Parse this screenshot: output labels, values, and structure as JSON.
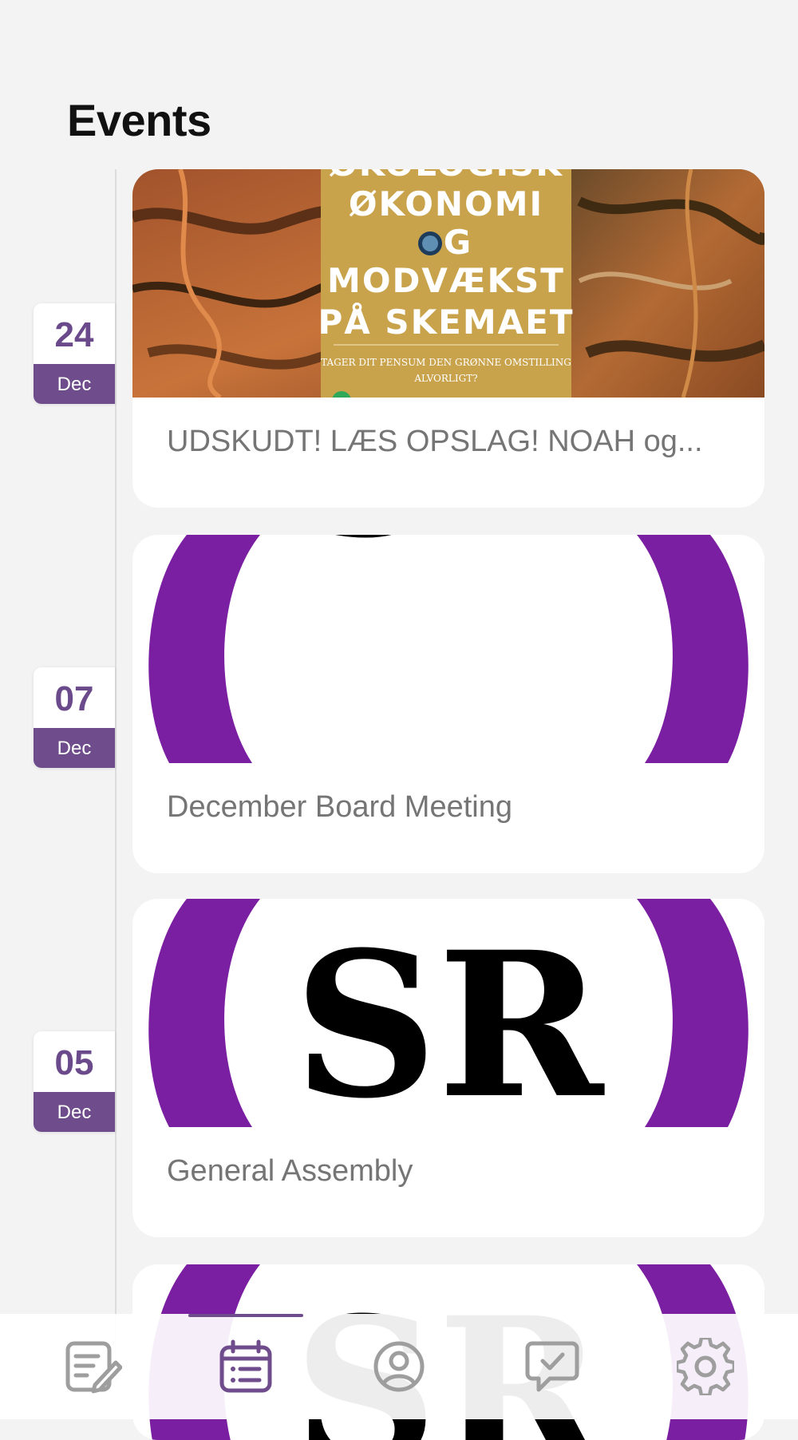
{
  "header": {
    "title": "Events"
  },
  "events": [
    {
      "day": "24",
      "month": "Dec",
      "title": "UDSKUDT! LÆS OPSLAG! NOAH og...",
      "poster_lines": [
        "ØKOLOGISK",
        "ØKONOMI",
        "G",
        "MODVÆKST",
        "PÅ SKEMAET"
      ],
      "poster_subtitle_1": "TAGER DIT PENSUM DEN GRØNNE OMSTILLING",
      "poster_subtitle_2": "ALVORLIGT?"
    },
    {
      "day": "07",
      "month": "Dec",
      "title": "December Board Meeting",
      "logo_text": "SR"
    },
    {
      "day": "05",
      "month": "Dec",
      "title": "General Assembly",
      "logo_text": "SR"
    },
    {
      "logo_text": "SR"
    }
  ],
  "colors": {
    "accent": "#6f4d8c",
    "logo_purple": "#7b1fa2",
    "background": "#f3f3f3",
    "poster_gold": "#c9a34c"
  },
  "bottom_nav": {
    "active_index": 1,
    "items": [
      {
        "icon": "notes-edit-icon"
      },
      {
        "icon": "calendar-icon"
      },
      {
        "icon": "profile-icon"
      },
      {
        "icon": "chat-check-icon"
      },
      {
        "icon": "gear-icon"
      }
    ]
  }
}
